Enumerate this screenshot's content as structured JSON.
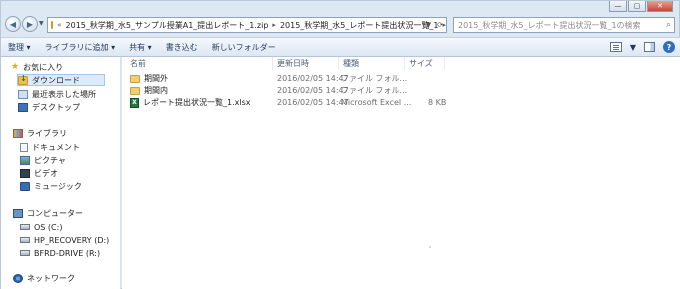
{
  "window": {
    "caption_buttons": {
      "minimize": "—",
      "maximize": "▢",
      "close": "✕"
    }
  },
  "address": {
    "crumbs": [
      "«",
      "2015_秋学期_水5_サンプル授業A1_提出レポート_1.zip",
      "▸",
      "2015_秋学期_水5_レポート提出状況一覧_1",
      "▸"
    ],
    "search_placeholder": "2015_秋学期_水5_レポート提出状況一覧_1の検索",
    "icons": {
      "back": "back-icon",
      "forward": "forward-icon",
      "search": "search-icon"
    }
  },
  "toolbar": {
    "organize": "整理 ▾",
    "add_to_library": "ライブラリに追加 ▾",
    "share": "共有 ▾",
    "burn": "書き込む",
    "new_folder": "新しいフォルダー"
  },
  "nav": {
    "favorites": "お気に入り",
    "downloads": "ダウンロード",
    "recent": "最近表示した場所",
    "desktop": "デスクトップ",
    "libraries": "ライブラリ",
    "documents": "ドキュメント",
    "pictures": "ピクチャ",
    "videos": "ビデオ",
    "music": "ミュージック",
    "computer": "コンピューター",
    "os_drive": "OS (C:)",
    "recovery_drive": "HP_RECOVERY (D:)",
    "bfrd_drive": "BFRD-DRIVE (R:)",
    "network": "ネットワーク"
  },
  "columns": {
    "name": "名前",
    "modified": "更新日時",
    "type": "種類",
    "size": "サイズ"
  },
  "files": [
    {
      "name": "期間外",
      "modified": "2016/02/05 14:47",
      "type": "ファイル フォル...",
      "size": "",
      "icon": "folder-icon"
    },
    {
      "name": "期間内",
      "modified": "2016/02/05 14:47",
      "type": "ファイル フォル...",
      "size": "",
      "icon": "folder-icon"
    },
    {
      "name": "レポート提出状況一覧_1.xlsx",
      "modified": "2016/02/05 14:47",
      "type": "Microsoft Excel ...",
      "size": "8 KB",
      "icon": "excel-file-icon"
    }
  ]
}
